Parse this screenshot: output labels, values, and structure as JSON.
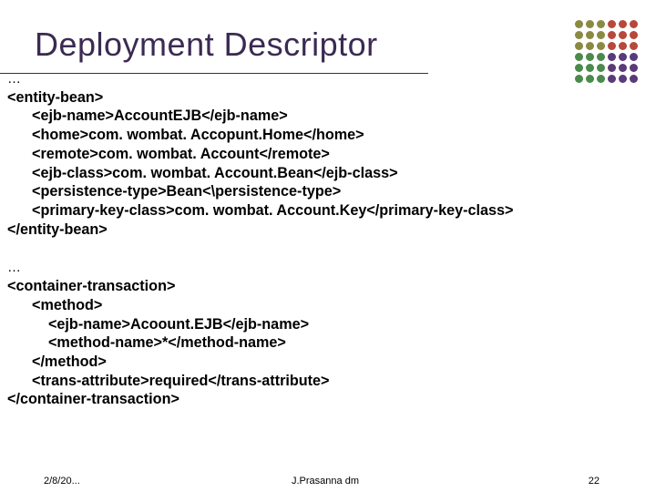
{
  "title": "Deployment Descriptor",
  "ellipsis_top": "…",
  "block1": {
    "l1": "<entity-bean>",
    "l2": "      <ejb-name>AccountEJB</ejb-name>",
    "l3": "      <home>com. wombat. Accopunt.Home</home>",
    "l4": "      <remote>com. wombat. Account</remote>",
    "l5": "      <ejb-class>com. wombat. Account.Bean</ejb-class>",
    "l6": "      <persistence-type>Bean<\\persistence-type>",
    "l7": "      <primary-key-class>com. wombat. Account.Key</primary-key-class>",
    "l8": "</entity-bean>"
  },
  "ellipsis_mid": "…",
  "block2": {
    "l1": "<container-transaction>",
    "l2": "      <method>",
    "l3": "          <ejb-name>Acoount.EJB</ejb-name>",
    "l4": "          <method-name>*</method-name>",
    "l5": "      </method>",
    "l6": "      <trans-attribute>required</trans-attribute>",
    "l7": "</container-transaction>"
  },
  "footer": {
    "date": "2/8/20...",
    "mid": "J.Prasanna dm",
    "page": "22"
  },
  "dot_colors": [
    "#8a8a42",
    "#8a8a42",
    "#8a8a42",
    "#b7483b",
    "#b7483b",
    "#b7483b",
    "#8a8a42",
    "#8a8a42",
    "#8a8a42",
    "#b7483b",
    "#b7483b",
    "#b7483b",
    "#8a8a42",
    "#8a8a42",
    "#8a8a42",
    "#b7483b",
    "#b7483b",
    "#b7483b",
    "#4a8a4a",
    "#4a8a4a",
    "#4a8a4a",
    "#5a3a7a",
    "#5a3a7a",
    "#5a3a7a",
    "#4a8a4a",
    "#4a8a4a",
    "#4a8a4a",
    "#5a3a7a",
    "#5a3a7a",
    "#5a3a7a",
    "#4a8a4a",
    "#4a8a4a",
    "#4a8a4a",
    "#5a3a7a",
    "#5a3a7a",
    "#5a3a7a"
  ]
}
